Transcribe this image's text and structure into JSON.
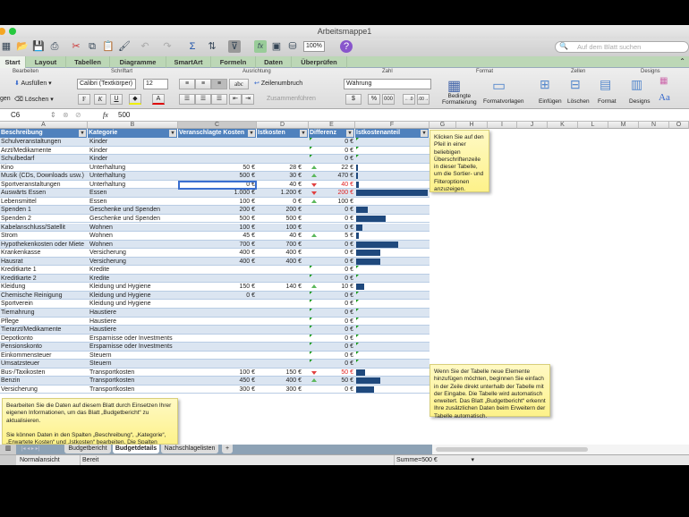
{
  "window": {
    "title": "Arbeitsmappe1"
  },
  "toolbar": {
    "zoom": "100%",
    "search_placeholder": "Auf dem Blatt suchen"
  },
  "tabs": [
    "Start",
    "Layout",
    "Tabellen",
    "Diagramme",
    "SmartArt",
    "Formeln",
    "Daten",
    "Überprüfen"
  ],
  "ribbon": {
    "groups": {
      "edit": "Bearbeiten",
      "font": "Schriftart",
      "align": "Ausrichtung",
      "number": "Zahl",
      "format": "Format",
      "cells": "Zellen",
      "designs": "Designs"
    },
    "fill": "Ausfüllen",
    "clear": "Löschen",
    "paste_partial": "gen",
    "font_name": "Calibri (Textkörper)",
    "font_size": "12",
    "bold": "F",
    "italic": "K",
    "underline": "U",
    "abc": "abc",
    "wrap": "Zeilenumbruch",
    "merge": "Zusammenführen",
    "number_format": "Währung",
    "percent": "%",
    "thousands": "000",
    "cond_format_1": "Bedingte",
    "cond_format_2": "Formatierung",
    "format_templates": "Formatvorlagen",
    "insert": "Einfügen",
    "delete": "Löschen",
    "format": "Format",
    "designs": "Designs",
    "aa": "Aa"
  },
  "formula_bar": {
    "cell_ref": "C6",
    "fx": "fx",
    "value": "500"
  },
  "columns": [
    "A",
    "B",
    "C",
    "D",
    "E",
    "F",
    "G",
    "H",
    "I",
    "J",
    "K",
    "L",
    "M",
    "N",
    "O"
  ],
  "table": {
    "headers": [
      "Beschreibung",
      "Kategorie",
      "Veranschlagte Kosten",
      "Istkosten",
      "Differenz",
      "Istkostenanteil"
    ],
    "max_actual": 1200,
    "rows": [
      [
        "Schulveranstaltungen",
        "Kinder",
        "",
        "",
        "0 €",
        null,
        "",
        0
      ],
      [
        "Arzt/Medikamente",
        "Kinder",
        "",
        "",
        "0 €",
        null,
        "",
        0
      ],
      [
        "Schulbedarf",
        "Kinder",
        "",
        "",
        "0 €",
        null,
        "",
        0
      ],
      [
        "Kino",
        "Unterhaltung",
        "50 €",
        "28 €",
        "22 €",
        "up",
        "",
        28
      ],
      [
        "Musik (CDs, Downloads usw.)",
        "Unterhaltung",
        "500 €",
        "30 €",
        "470 €",
        "up",
        "",
        30
      ],
      [
        "Sportveranstaltungen",
        "Unterhaltung",
        "0 €",
        "40 €",
        "40 €",
        "down",
        "neg",
        40
      ],
      [
        "Auswärts Essen",
        "Essen",
        "1.000 €",
        "1.200 €",
        "200 €",
        "down",
        "neg",
        1200
      ],
      [
        "Lebensmittel",
        "Essen",
        "100 €",
        "0 €",
        "100 €",
        "up",
        "",
        0
      ],
      [
        "Spenden 1",
        "Geschenke und Spenden",
        "200 €",
        "200 €",
        "0 €",
        "",
        "",
        200
      ],
      [
        "Spenden 2",
        "Geschenke und Spenden",
        "500 €",
        "500 €",
        "0 €",
        "",
        "",
        500
      ],
      [
        "Kabelanschluss/Satellit",
        "Wohnen",
        "100 €",
        "100 €",
        "0 €",
        "",
        "",
        100
      ],
      [
        "Strom",
        "Wohnen",
        "45 €",
        "40 €",
        "5 €",
        "up",
        "",
        40
      ],
      [
        "Hypothekenkosten oder Miete",
        "Wohnen",
        "700 €",
        "700 €",
        "0 €",
        "",
        "",
        700
      ],
      [
        "Krankenkasse",
        "Versicherung",
        "400 €",
        "400 €",
        "0 €",
        "",
        "",
        400
      ],
      [
        "Hausrat",
        "Versicherung",
        "400 €",
        "400 €",
        "0 €",
        "",
        "",
        400
      ],
      [
        "Kreditkarte 1",
        "Kredite",
        "",
        "",
        "0 €",
        null,
        "",
        0
      ],
      [
        "Kreditkarte 2",
        "Kredite",
        "",
        "",
        "0 €",
        null,
        "",
        0
      ],
      [
        "Kleidung",
        "Kleidung und Hygiene",
        "150 €",
        "140 €",
        "10 €",
        "up",
        "",
        140
      ],
      [
        "Chemische Reinigung",
        "Kleidung und Hygiene",
        "0 €",
        "",
        "0 €",
        null,
        "",
        0
      ],
      [
        "Sportverein",
        "Kleidung und Hygiene",
        "",
        "",
        "0 €",
        null,
        "",
        0
      ],
      [
        "Tiernahrung",
        "Haustiere",
        "",
        "",
        "0 €",
        null,
        "",
        0
      ],
      [
        "Pflege",
        "Haustiere",
        "",
        "",
        "0 €",
        null,
        "",
        0
      ],
      [
        "Tierarzt/Medikamente",
        "Haustiere",
        "",
        "",
        "0 €",
        null,
        "",
        0
      ],
      [
        "Depotkonto",
        "Ersparnisse oder Investments",
        "",
        "",
        "0 €",
        null,
        "",
        0
      ],
      [
        "Pensionskonto",
        "Ersparnisse oder Investments",
        "",
        "",
        "0 €",
        null,
        "",
        0
      ],
      [
        "Einkommensteuer",
        "Steuern",
        "",
        "",
        "0 €",
        null,
        "",
        0
      ],
      [
        "Umsatzsteuer",
        "Steuern",
        "",
        "",
        "0 €",
        null,
        "",
        0
      ],
      [
        "Bus-/Taxikosten",
        "Transportkosten",
        "100 €",
        "150 €",
        "50 €",
        "down",
        "neg",
        150
      ],
      [
        "Benzin",
        "Transportkosten",
        "450 €",
        "400 €",
        "50 €",
        "up",
        "",
        400
      ],
      [
        "Versicherung",
        "Transportkosten",
        "300 €",
        "300 €",
        "0 €",
        "",
        "",
        300
      ]
    ]
  },
  "notes": {
    "filter": "Klicken Sie auf den Pfeil in einer beliebigen Überschriftenzeile in dieser Tabelle, um die Sortier- und Filteroptionen anzuzeigen.",
    "extend": "Wenn Sie der Tabelle neue Elemente hinzufügen möchten, beginnen Sie einfach in der Zeile direkt unterhalb der Tabelle mit der Eingabe. Die Tabelle wird automatisch erweitert. Das Blatt „Budgetbericht“ erkennt Ihre zusätzlichen Daten beim Erweitern der Tabelle automatisch.",
    "edit_1": "Bearbeiten Sie die Daten auf diesem Blatt durch Einsetzen Ihrer eigenen Informationen, um das Blatt „Budgetbericht“ zu aktualisieren.",
    "edit_2": "Sie können Daten in den Spalten „Beschreibung“, „Kategorie“, „Erwartete Kosten“ und „Istkosten“ bearbeiten. Die Spalten"
  },
  "sheets": [
    "Budgetbericht",
    "Budgetdetails",
    "Nachschlagelisten"
  ],
  "add_sheet": "+",
  "status": {
    "view": "Normalansicht",
    "state": "Bereit",
    "sum": "Summe=500 €"
  },
  "colors": {
    "header": "#4f81bd",
    "band": "#dbe5f1",
    "bar": "#1f497d",
    "ribbon_tabs": "#bcd7b6"
  }
}
